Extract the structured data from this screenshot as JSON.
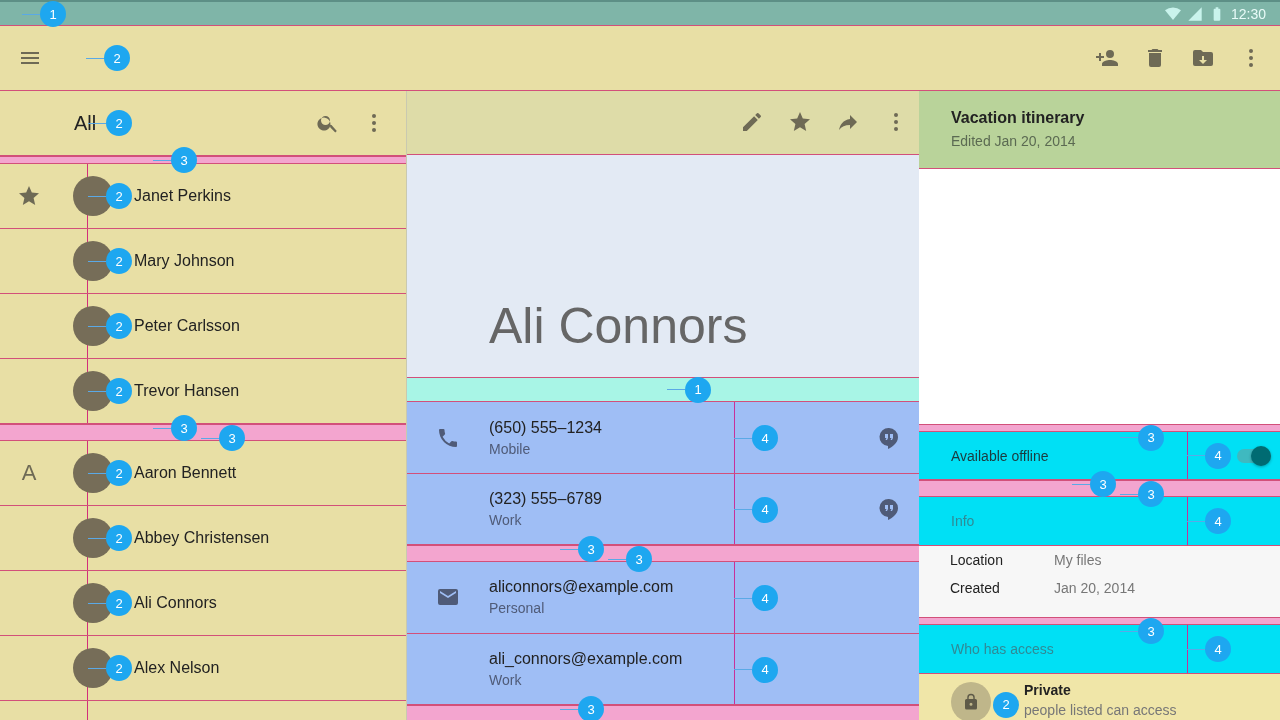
{
  "status_bar": {
    "time": "12:30",
    "marker": "1"
  },
  "app_bar": {
    "marker": "2"
  },
  "contacts": {
    "title": "All",
    "marker": "2",
    "sections": [
      {
        "kind": "starred",
        "markers_above": [
          "3"
        ],
        "items": [
          {
            "name": "Janet Perkins",
            "marker": "2"
          },
          {
            "name": "Mary Johnson",
            "marker": "2"
          },
          {
            "name": "Peter Carlsson",
            "marker": "2"
          },
          {
            "name": "Trevor Hansen",
            "marker": "2"
          }
        ]
      },
      {
        "kind": "letter",
        "letter": "A",
        "markers_above": [
          "3",
          "3"
        ],
        "items": [
          {
            "name": "Aaron Bennett",
            "marker": "2"
          },
          {
            "name": "Abbey Christensen",
            "marker": "2"
          },
          {
            "name": "Ali Connors",
            "marker": "2"
          },
          {
            "name": "Alex Nelson",
            "marker": "2"
          }
        ]
      }
    ]
  },
  "detail": {
    "name": "Ali Connors",
    "strip_marker": "1",
    "groups": [
      {
        "kind": "phone",
        "items": [
          {
            "value": "(650) 555–1234",
            "label": "Mobile",
            "chat_button": true,
            "marker": "4"
          },
          {
            "value": "(323) 555–6789",
            "label": "Work",
            "chat_button": true,
            "marker": "4"
          }
        ]
      },
      {
        "kind": "email",
        "markers_above": [
          "3",
          "3"
        ],
        "items": [
          {
            "value": "aliconnors@example.com",
            "label": "Personal",
            "chat_button": false,
            "marker": "4"
          },
          {
            "value": "ali_connors@example.com",
            "label": "Work",
            "chat_button": false,
            "marker": "4"
          }
        ]
      }
    ],
    "bottom_marker": "3"
  },
  "file": {
    "title": "Vacation itinerary",
    "subtitle": "Edited Jan 20, 2014",
    "offline": {
      "label": "Available offline",
      "on": true,
      "marker_above": "3",
      "marker": "4"
    },
    "info": {
      "label": "Info",
      "markers_above": [
        "3",
        "3"
      ],
      "marker": "4",
      "rows": [
        {
          "key": "Location",
          "value": "My files"
        },
        {
          "key": "Created",
          "value": "Jan 20, 2014"
        }
      ]
    },
    "access": {
      "label": "Who has access",
      "marker_above": "3",
      "marker": "4",
      "owner": {
        "title": "Private",
        "subtitle": "people listed can access",
        "marker": "2"
      }
    }
  }
}
